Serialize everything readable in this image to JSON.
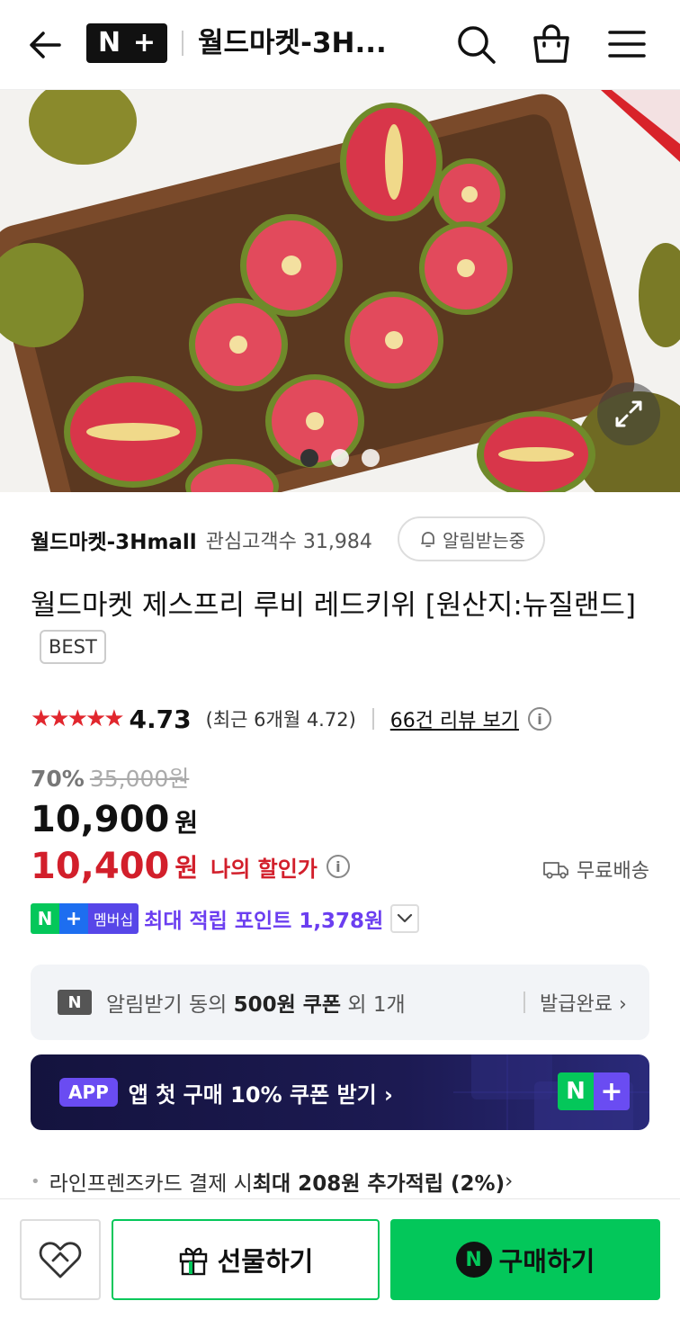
{
  "header": {
    "title": "월드마켓-3H...",
    "logo_n": "N",
    "logo_plus": "+",
    "icons": [
      "back-arrow-icon",
      "search-icon",
      "shopping-bag-icon",
      "menu-icon"
    ]
  },
  "hero": {
    "slide_count": 3,
    "active_slide": 1
  },
  "store": {
    "name": "월드마켓-3Hmall",
    "fans": "관심고객수 31,984",
    "alarm_label": "알림받는중"
  },
  "product": {
    "title": "월드마켓 제스프리 루비 레드키위 [원산지:뉴질랜드]",
    "badge": "BEST"
  },
  "rating": {
    "stars": "★★★★★",
    "score": "4.73",
    "recent": "(최근 6개월 4.72)",
    "reviews_link": "66건 리뷰 보기",
    "info": "i"
  },
  "price": {
    "discount": "70%",
    "original": "35,000원",
    "sale": "10,900",
    "won": "원",
    "my_price": "10,400",
    "my_won": "원",
    "my_label": "나의 할인가",
    "delivery": "무료배송"
  },
  "membership": {
    "badge_n": "N",
    "badge_plus": "+",
    "badge_text": "멤버십",
    "points": "최대 적립 포인트 1,378원"
  },
  "coupon": {
    "icon_text": "N",
    "prefix": "알림받기 동의 ",
    "amount": "500원 쿠폰",
    "suffix": " 외 1개",
    "status": "발급완료 ›"
  },
  "app_banner": {
    "tag": "APP",
    "text": "앱 첫 구매 10% 쿠폰 받기 ›",
    "logo_n": "N",
    "logo_plus": "+"
  },
  "card_promo": {
    "prefix": "라인프렌즈카드 결제 시 ",
    "highlight": "최대 208원 추가적립 (2%)",
    "suffix": " ›"
  },
  "bottom": {
    "gift_label": "선물하기",
    "buy_label": "구매하기",
    "buy_icon": "N"
  },
  "colors": {
    "naver_green": "#03c75a",
    "sale_red": "#d21f2b",
    "points_purple": "#6b3ef0",
    "banner_navy": "#1c1a52"
  }
}
